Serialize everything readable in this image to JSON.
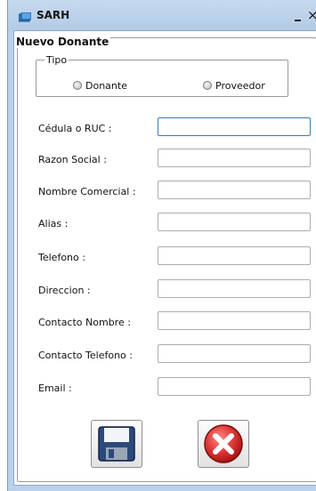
{
  "window": {
    "title": "SARH",
    "minimize_glyph": "–",
    "close_glyph": "×"
  },
  "form": {
    "group_title": "Nuevo Donante",
    "tipo": {
      "legend": "Tipo",
      "options": [
        {
          "label": "Donante",
          "selected": false
        },
        {
          "label": "Proveedor",
          "selected": false
        }
      ]
    },
    "fields": [
      {
        "label": "Cédula o RUC :",
        "value": ""
      },
      {
        "label": "Razon Social :",
        "value": ""
      },
      {
        "label": "Nombre Comercial  :",
        "value": ""
      },
      {
        "label": "Alias :",
        "value": ""
      },
      {
        "label": "Telefono :",
        "value": ""
      },
      {
        "label": "Direccion :",
        "value": ""
      },
      {
        "label": "Contacto Nombre :",
        "value": ""
      },
      {
        "label": "Contacto Telefono :",
        "value": ""
      },
      {
        "label": "Email :",
        "value": ""
      }
    ],
    "buttons": {
      "save_icon": "floppy-disk-icon",
      "cancel_icon": "red-x-icon"
    }
  },
  "colors": {
    "titlebar": "#b9d1ea",
    "cancel_red": "#d62a2a",
    "floppy_blue": "#2b4a7a"
  }
}
